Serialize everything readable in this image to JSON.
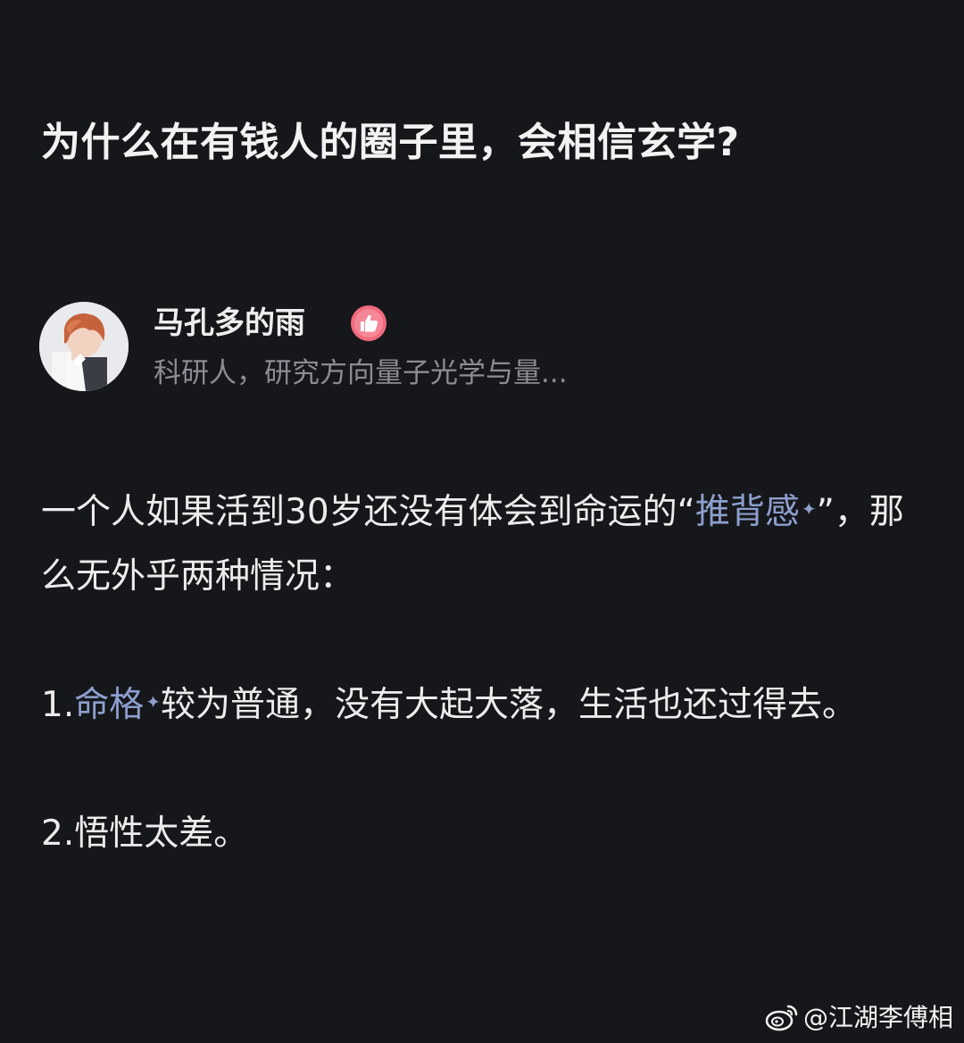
{
  "question": {
    "title": "为什么在有钱人的圈子里，会相信玄学?"
  },
  "author": {
    "name": "马孔多的雨",
    "bio": "科研人，研究方向量子光学与量...",
    "badge_icon": "thumbs-up-badge-icon",
    "badge_color": "#f06a7e"
  },
  "answer": {
    "p1_part1": "一个人如果活到30岁还没有体会到命运的“",
    "p1_link": "推背感",
    "p1_part2": "”，那么无外乎两种情况：",
    "p2_prefix": "1.",
    "p2_link": "命格",
    "p2_part2": "较为普通，没有大起大落，生活也还过得去。",
    "p3": "2.悟性太差。",
    "link_color": "#8c9fcd"
  },
  "watermark": {
    "text": "@江湖李傅相",
    "icon": "weibo-icon"
  }
}
